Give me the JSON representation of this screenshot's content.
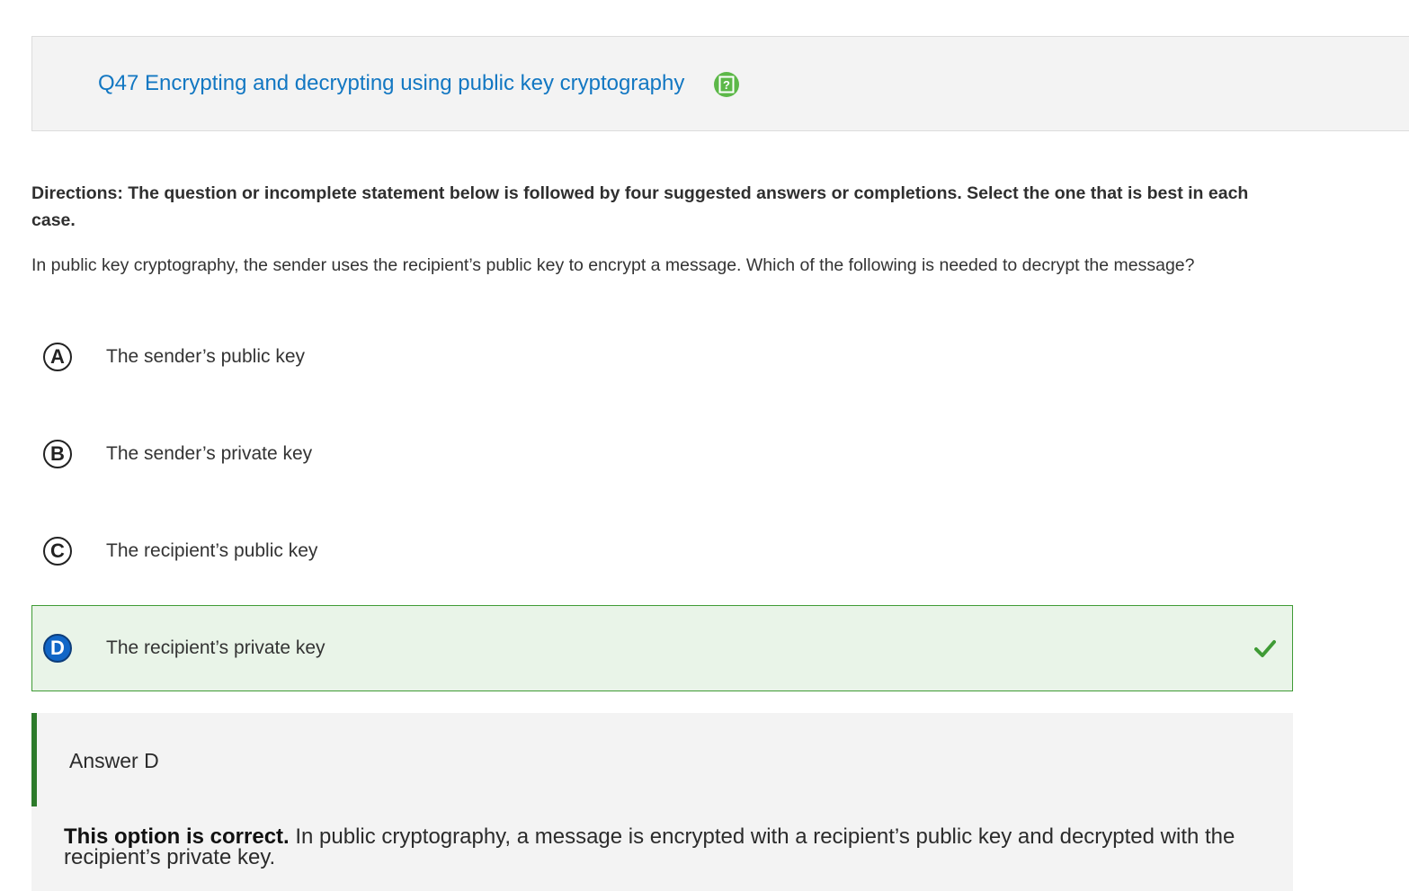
{
  "header": {
    "title": "Q47 Encrypting and decrypting using public key cryptography",
    "help_icon": "question-mark-icon",
    "help_icon_color": "#5cb848",
    "title_color": "#1277c2"
  },
  "directions": "Directions: The question or incomplete statement below is followed by four suggested answers or completions. Select the one that is best in each case.",
  "question": "In public key cryptography, the sender uses the recipient’s public key to encrypt a message. Which of the following is needed to decrypt the message?",
  "options": [
    {
      "letter": "A",
      "text": "The sender’s public key",
      "correct": false
    },
    {
      "letter": "B",
      "text": "The sender’s private key",
      "correct": false
    },
    {
      "letter": "C",
      "text": "The recipient’s public key",
      "correct": false
    },
    {
      "letter": "D",
      "text": "The recipient’s private key",
      "correct": true
    }
  ],
  "correct_indicator_icon": "checkmark-icon",
  "correct_color": "#3f9b35",
  "answer": {
    "title": "Answer D",
    "lead": "This option is correct.",
    "body": " In public cryptography, a message is encrypted with a recipient’s public key and decrypted with the recipient’s private key."
  }
}
